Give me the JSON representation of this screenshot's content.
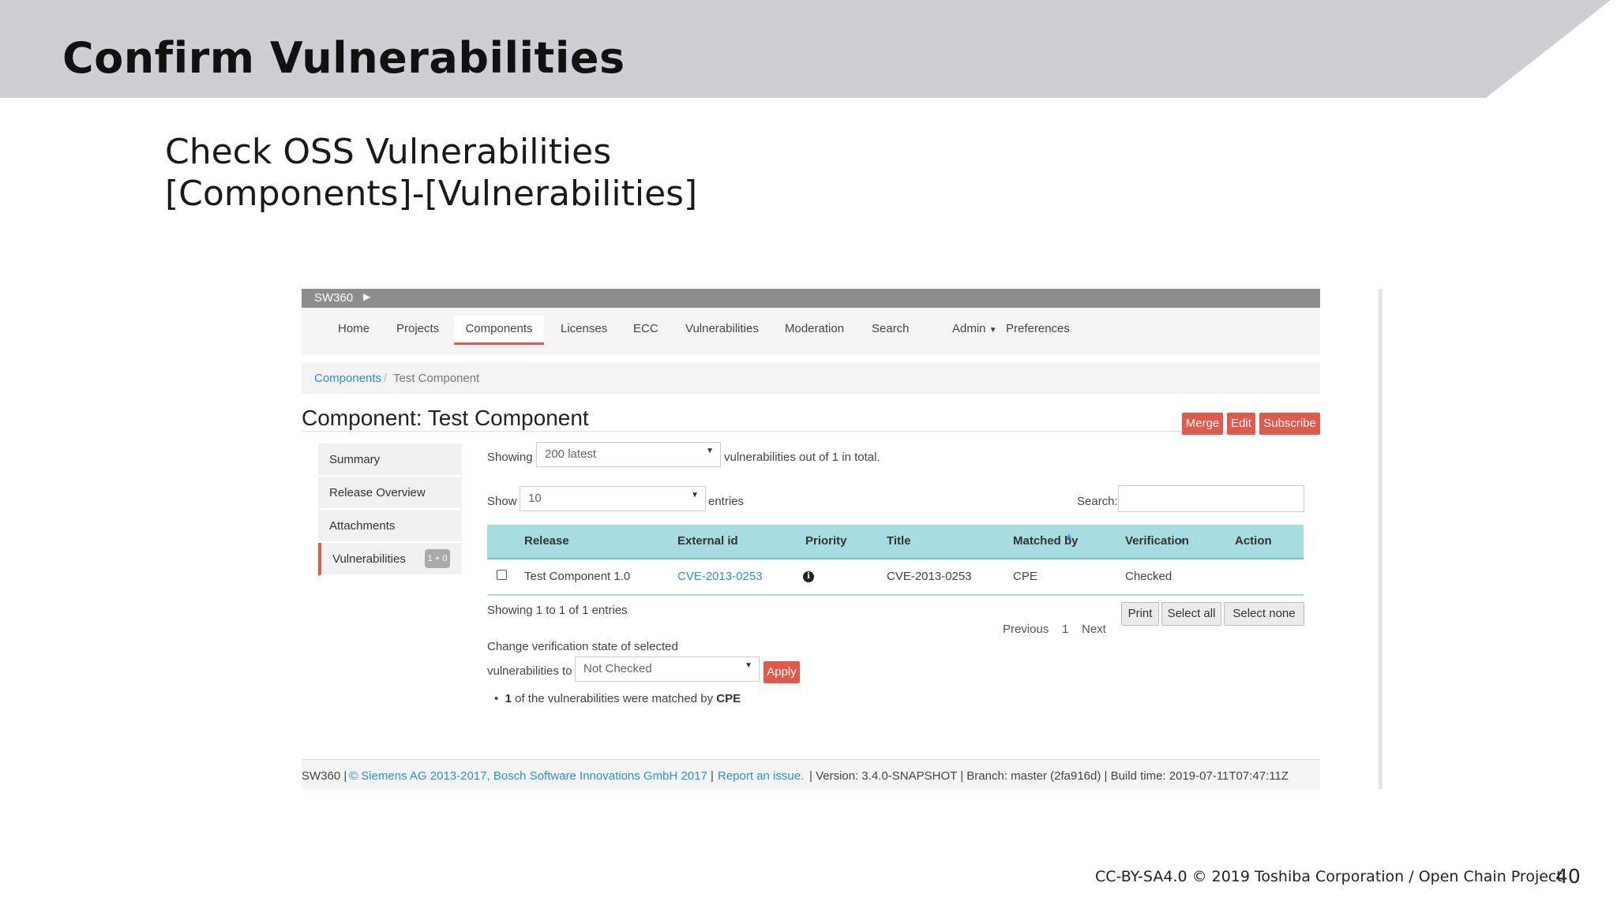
{
  "slide": {
    "title": "Confirm Vulnerabilities",
    "subtitle_line1": "Check OSS Vulnerabilities",
    "subtitle_line2": "[Components]-[Vulnerabilities]",
    "credit": "CC-BY-SA4.0 © 2019 Toshiba Corporation / Open Chain Project",
    "page_number": "40",
    "band_color": "#cfced3"
  },
  "app": {
    "brand": "SW360",
    "nav": [
      "Home",
      "Projects",
      "Components",
      "Licenses",
      "ECC",
      "Vulnerabilities",
      "Moderation",
      "Search",
      "Admin",
      "Preferences"
    ],
    "active_nav": "Components",
    "breadcrumb": {
      "root": "Components",
      "separator": "/",
      "current": "Test Component"
    },
    "page_title": "Component: Test Component",
    "actions": {
      "merge": "Merge",
      "edit": "Edit",
      "subscribe": "Subscribe"
    },
    "sidebar": [
      {
        "label": "Summary"
      },
      {
        "label": "Release Overview"
      },
      {
        "label": "Attachments"
      },
      {
        "label": "Vulnerabilities",
        "badge": "1 + 0"
      }
    ],
    "showing": {
      "prefix": "Showing",
      "selected": "200 latest",
      "suffix": "vulnerabilities out of 1 in total."
    },
    "length": {
      "prefix": "Show",
      "selected": "10",
      "suffix": "entries"
    },
    "search_label": "Search:",
    "table": {
      "headers": [
        "Release",
        "External id",
        "Priority",
        "Title",
        "Matched by",
        "Verification",
        "Action"
      ],
      "rows": [
        {
          "release": "Test Component 1.0",
          "external_id": "CVE-2013-0253",
          "priority_icon": "info-icon",
          "title": "CVE-2013-0253",
          "matched_by": "CPE",
          "verification": "Checked",
          "action": ""
        }
      ]
    },
    "info": "Showing 1 to 1 of 1 entries",
    "pagination": {
      "previous": "Previous",
      "page": "1",
      "next": "Next"
    },
    "table_buttons": {
      "print": "Print",
      "select_all": "Select all",
      "select_none": "Select none"
    },
    "change_state": {
      "line1": "Change verification state of selected",
      "line2": "vulnerabilities to",
      "selected": "Not Checked",
      "apply": "Apply"
    },
    "matched_note": {
      "count": "1",
      "text": " of the vulnerabilities were matched by ",
      "by": "CPE"
    },
    "footer": {
      "brand": "SW360 |",
      "copyright": "© Siemens AG 2013-2017, Bosch Software Innovations GmbH 2017",
      "sep1": "|",
      "report": "Report an issue.",
      "details": "| Version: 3.4.0-SNAPSHOT | Branch: master (2fa916d) | Build time: 2019-07-11T07:47:11Z"
    },
    "accent_color": "#e0594a",
    "table_header_color": "#a7dde1",
    "link_color": "#2a8fd5"
  }
}
